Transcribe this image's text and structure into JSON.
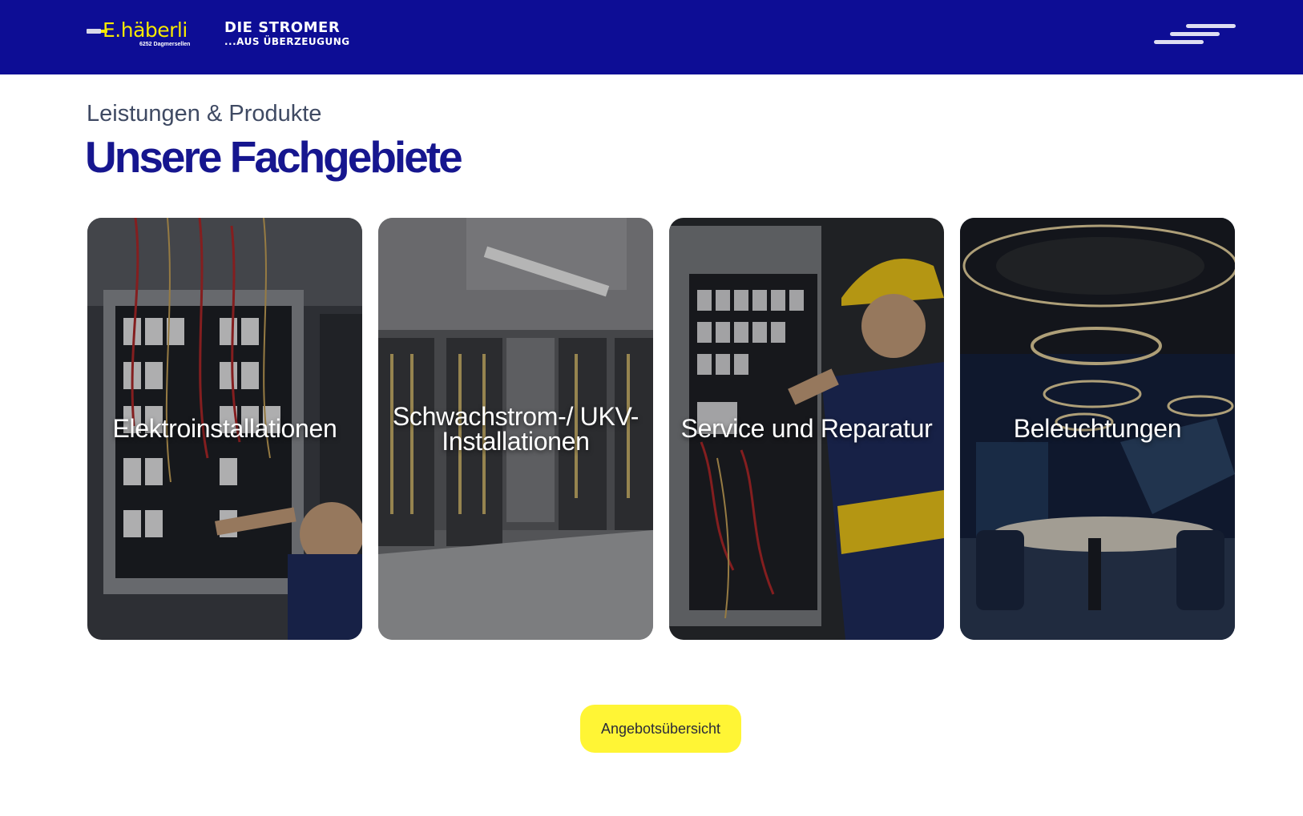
{
  "header": {
    "logo": {
      "brand": "E.häberli",
      "sub": "6252 Dagmersellen"
    },
    "slogan": {
      "line1": "DIE STROMER",
      "line2": "...AUS ÜBERZEUGUNG"
    },
    "menu_icon": "hamburger-menu-icon"
  },
  "section": {
    "eyebrow": "Leistungen & Produkte",
    "headline": "Unsere Fachgebiete"
  },
  "cards": [
    {
      "label": "Elektroinstallationen"
    },
    {
      "label": "Schwachstrom-/ UKV-Installationen"
    },
    {
      "label": "Service und Reparatur"
    },
    {
      "label": "Beleuchtungen"
    }
  ],
  "cta": {
    "label": "Angebotsübersicht"
  },
  "colors": {
    "header_bg": "#0d0d95",
    "headline": "#16168f",
    "accent_yellow": "#fff535",
    "logo_yellow": "#f5e800"
  }
}
